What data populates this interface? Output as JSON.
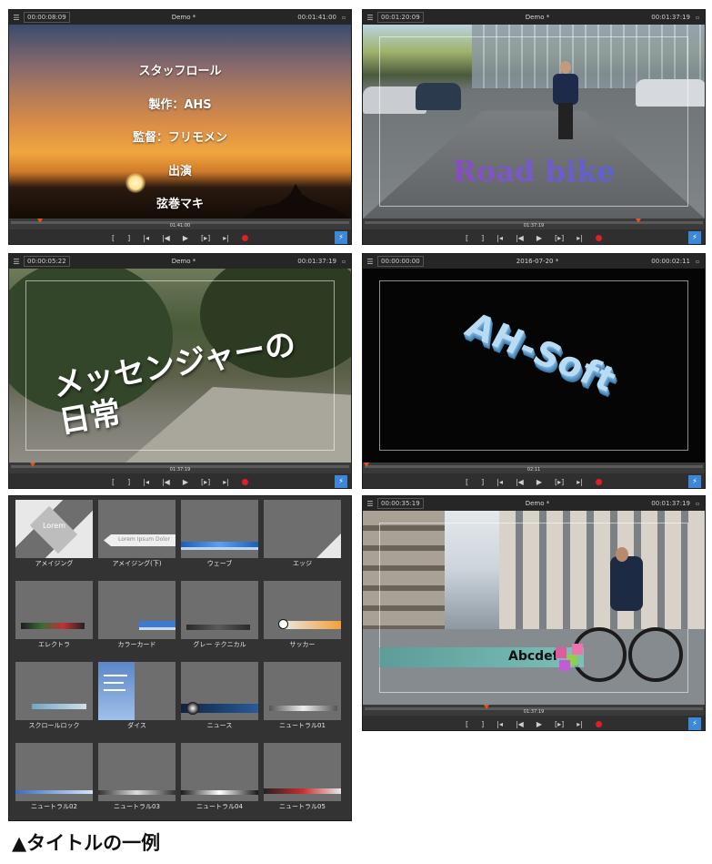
{
  "panels": [
    {
      "timecode": "00:00:08:09",
      "title": "Demo *",
      "duration": "00:01:41:00",
      "timeline_time": "01:41:00"
    },
    {
      "timecode": "00:01:20:09",
      "title": "Demo *",
      "duration": "00:01:37:19",
      "timeline_time": "01:37:19"
    },
    {
      "timecode": "00:00:05:22",
      "title": "Demo *",
      "duration": "00:01:37:19",
      "timeline_time": "01:37:19"
    },
    {
      "timecode": "00:00:00:00",
      "title": "2016-07-20 *",
      "duration": "00:00:02:11",
      "timeline_time": "02:11"
    },
    {
      "timecode": "00:00:35:19",
      "title": "Demo *",
      "duration": "00:01:37:19",
      "timeline_time": "01:37:19"
    }
  ],
  "controls": {
    "menu_glyph": "☰",
    "corner_glyph": "▫",
    "bracket_in": "[",
    "bracket_out": "]",
    "prev_mark": "|◂",
    "prev": "|◀",
    "play": "▶",
    "next_bracket": "[▸]",
    "next_mark": "▸|",
    "flash": "⚡"
  },
  "credits": {
    "lines": [
      "スタッフロール",
      "製作：AHS",
      "監督：フリモメン",
      "出演",
      "弦巻マキ"
    ]
  },
  "roadbike": {
    "text": "Road bike"
  },
  "messenger": {
    "line1": "メッセンジャーの",
    "line2": "日常"
  },
  "text3d": {
    "text": "AH-Soft"
  },
  "abcdef": {
    "text": "Abcdef"
  },
  "title_grid": {
    "items": [
      {
        "label": "アメイジング",
        "thumb_text": "Lorem"
      },
      {
        "label": "アメイジング(下)",
        "thumb_text": "Lorem Ipsum Dolor"
      },
      {
        "label": "ウェーブ",
        "thumb_text": ""
      },
      {
        "label": "エッジ",
        "thumb_text": ""
      },
      {
        "label": "エレクトラ",
        "thumb_text": ""
      },
      {
        "label": "カラーカード",
        "thumb_text": ""
      },
      {
        "label": "グレー テクニカル",
        "thumb_text": ""
      },
      {
        "label": "サッカー",
        "thumb_text": ""
      },
      {
        "label": "スクロールロック",
        "thumb_text": ""
      },
      {
        "label": "ダイス",
        "thumb_text": ""
      },
      {
        "label": "ニュース",
        "thumb_text": ""
      },
      {
        "label": "ニュートラル01",
        "thumb_text": ""
      },
      {
        "label": "ニュートラル02",
        "thumb_text": ""
      },
      {
        "label": "ニュートラル03",
        "thumb_text": ""
      },
      {
        "label": "ニュートラル04",
        "thumb_text": ""
      },
      {
        "label": "ニュートラル05",
        "thumb_text": ""
      }
    ]
  },
  "caption": "▲タイトルの一例",
  "colors": {
    "accent": "#3c88d8",
    "record": "#e02020",
    "marker": "#e8501e"
  }
}
